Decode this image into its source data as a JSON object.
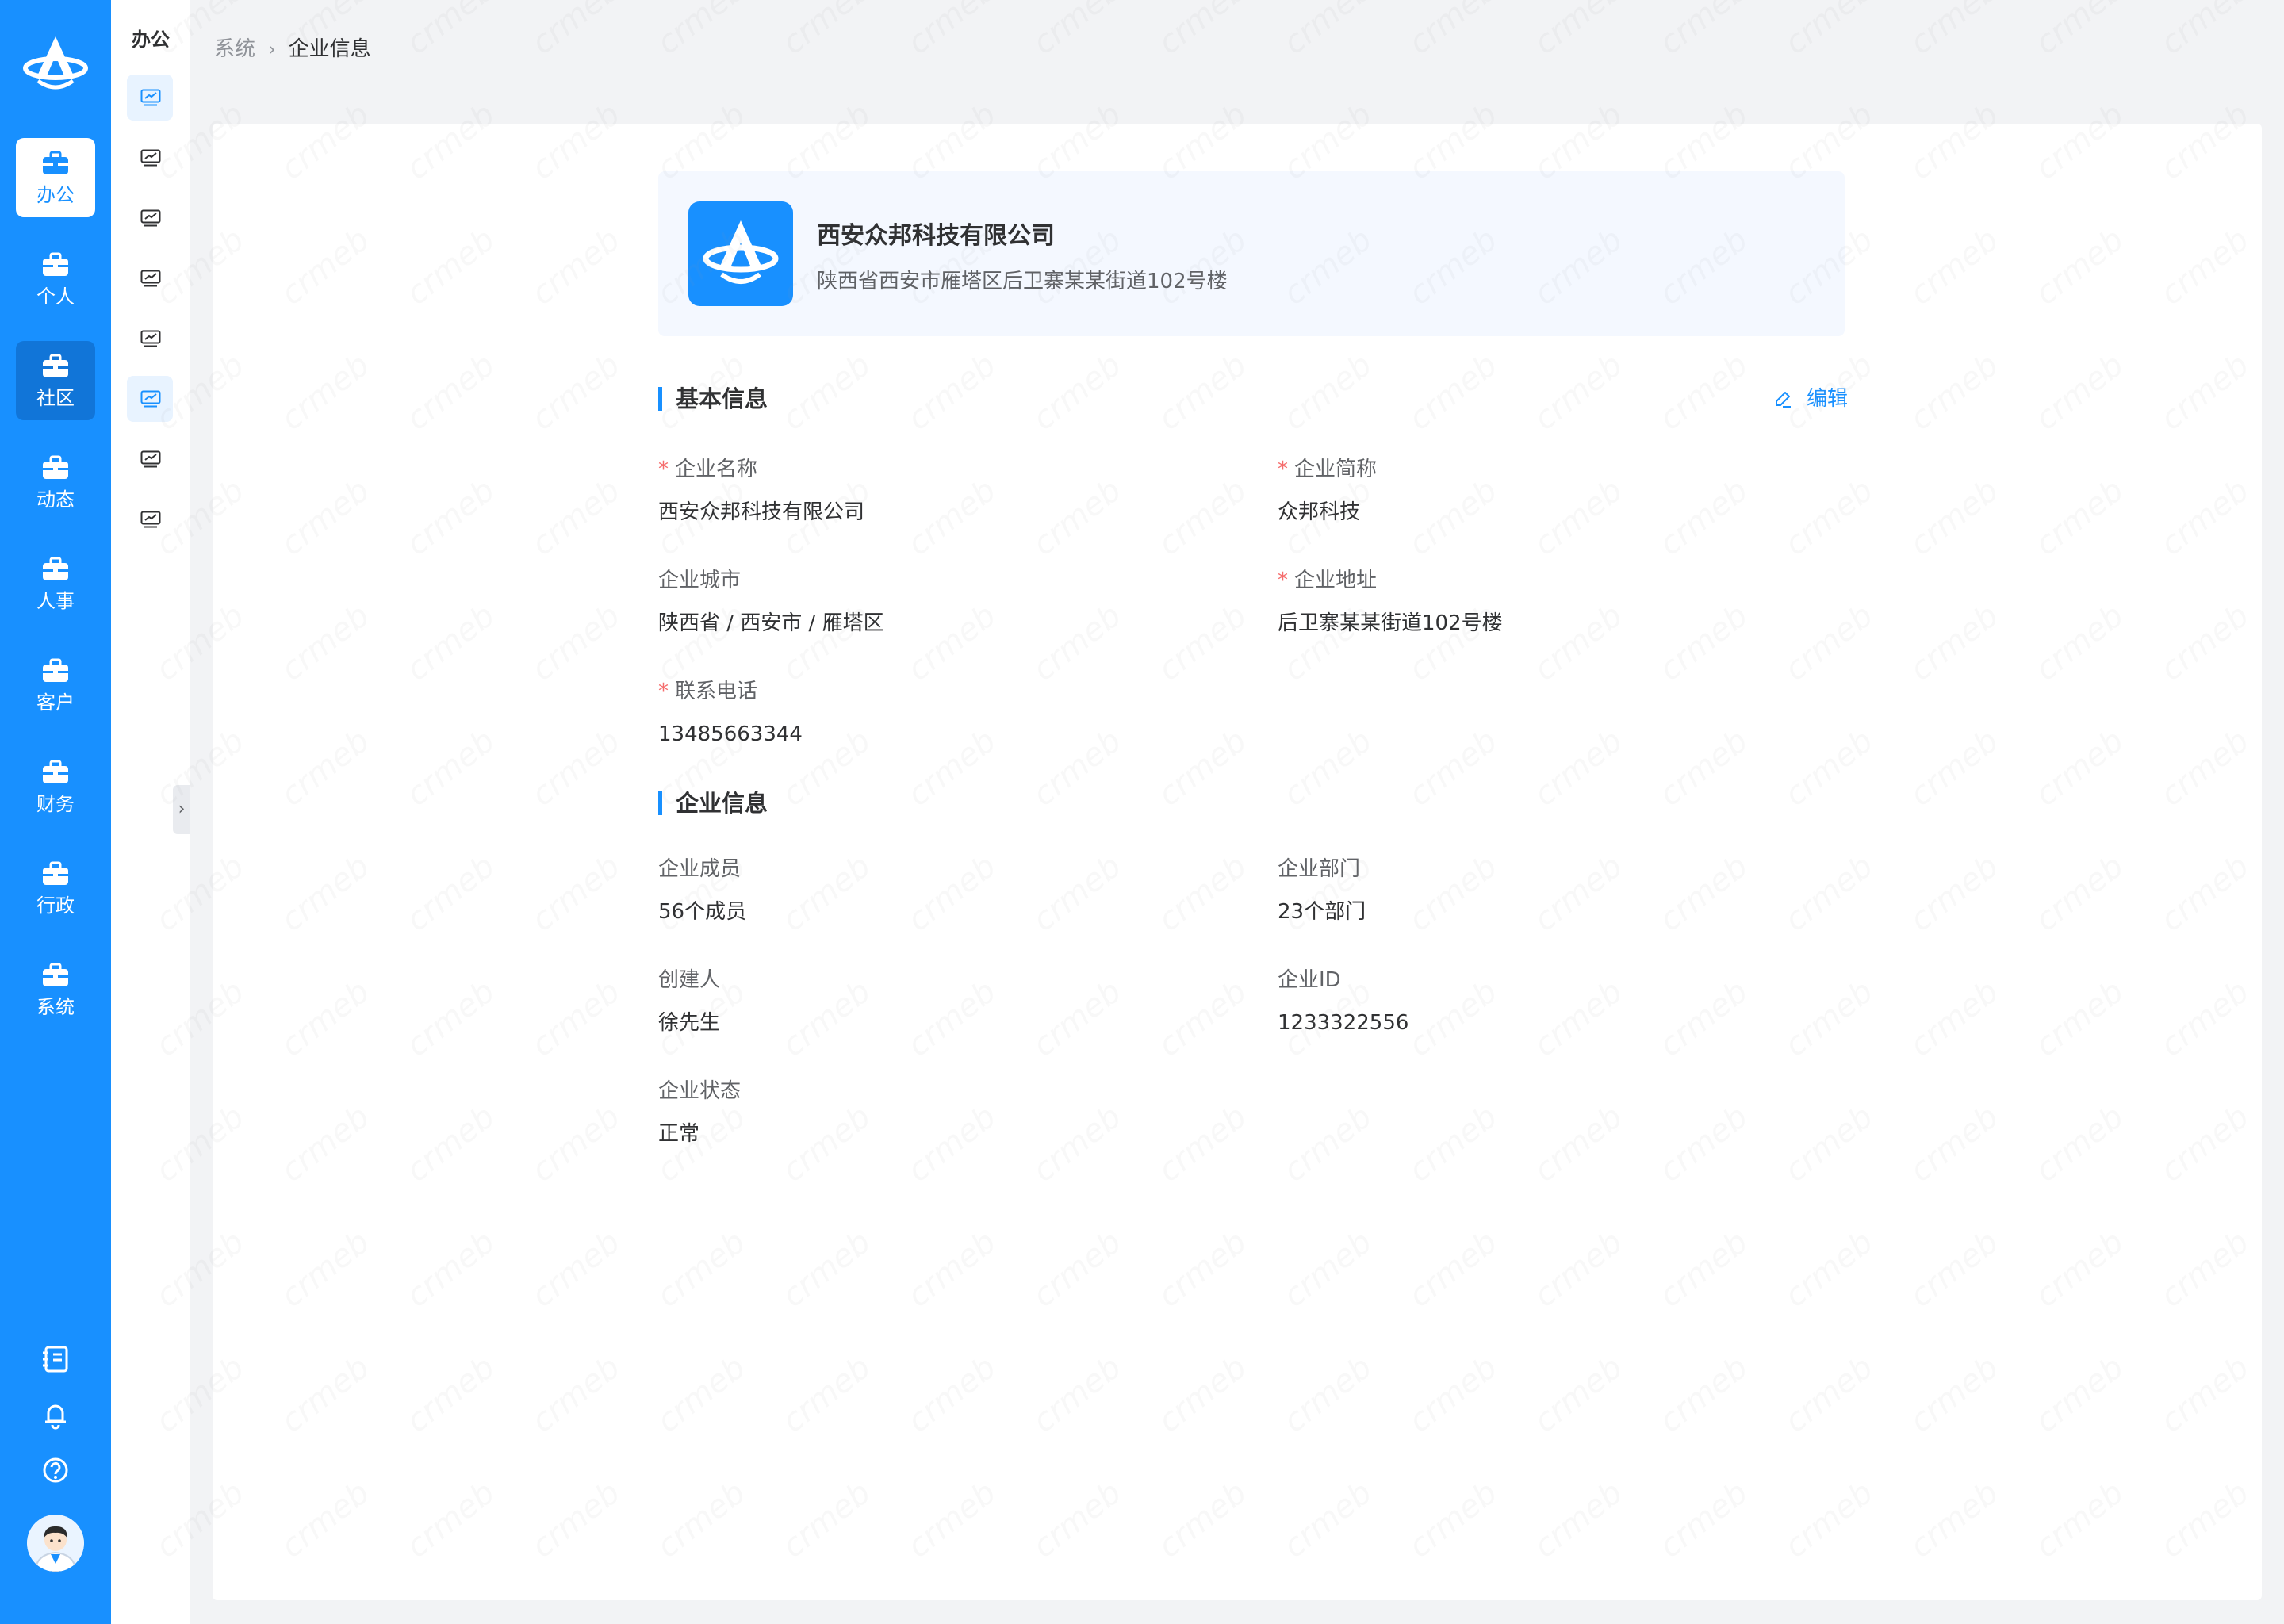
{
  "sidebar": {
    "items": [
      {
        "label": "办公",
        "icon": "briefcase-icon"
      },
      {
        "label": "个人",
        "icon": "briefcase-icon"
      },
      {
        "label": "社区",
        "icon": "briefcase-icon"
      },
      {
        "label": "动态",
        "icon": "briefcase-icon"
      },
      {
        "label": "人事",
        "icon": "briefcase-icon"
      },
      {
        "label": "客户",
        "icon": "briefcase-icon"
      },
      {
        "label": "财务",
        "icon": "briefcase-icon"
      },
      {
        "label": "行政",
        "icon": "briefcase-icon"
      },
      {
        "label": "系统",
        "icon": "briefcase-icon"
      }
    ],
    "active_item": "办公",
    "tools": [
      "notebook-icon",
      "bell-icon",
      "help-icon"
    ],
    "accent_color": "#1890ff"
  },
  "subnav": {
    "title": "办公",
    "item_icon": "chart-monitor-icon"
  },
  "breadcrumb": {
    "parent": "系统",
    "current": "企业信息"
  },
  "company": {
    "name": "西安众邦科技有限公司",
    "address": "陕西省西安市雁塔区后卫寨某某街道102号楼"
  },
  "basic_info": {
    "title": "基本信息",
    "edit_label": "编辑",
    "fields": [
      {
        "label": "企业名称",
        "value": "西安众邦科技有限公司",
        "required": true
      },
      {
        "label": "企业简称",
        "value": "众邦科技",
        "required": true
      },
      {
        "label": "企业城市",
        "value": "陕西省 / 西安市 / 雁塔区",
        "required": false
      },
      {
        "label": "企业地址",
        "value": "后卫寨某某街道102号楼",
        "required": true
      },
      {
        "label": "联系电话",
        "value": "13485663344",
        "required": true
      }
    ]
  },
  "company_info": {
    "title": "企业信息",
    "fields": [
      {
        "label": "企业成员",
        "value": "56个成员"
      },
      {
        "label": "企业部门",
        "value": "23个部门"
      },
      {
        "label": "创建人",
        "value": "徐先生"
      },
      {
        "label": "企业ID",
        "value": "1233322556"
      },
      {
        "label": "企业状态",
        "value": "正常"
      }
    ]
  },
  "watermark_text": "crmeb"
}
